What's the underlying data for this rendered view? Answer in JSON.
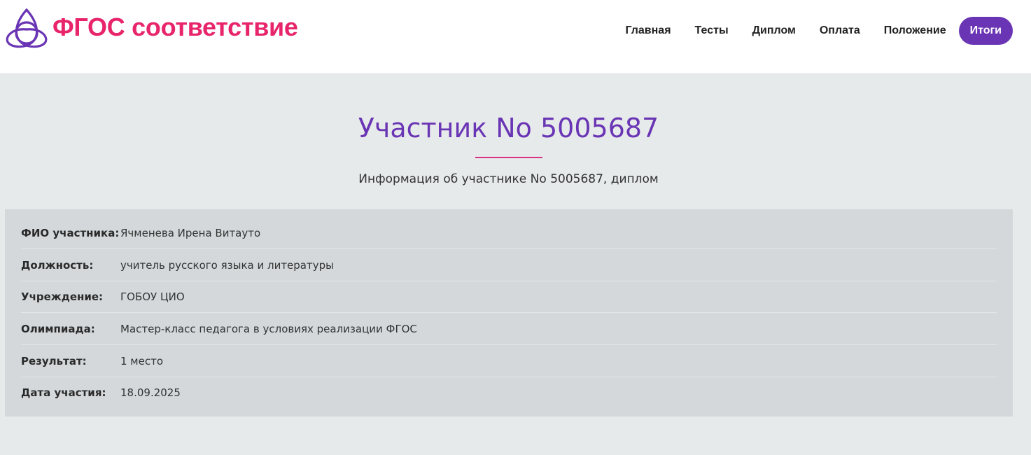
{
  "header": {
    "logo_text": "ФГОС соответствие",
    "logo_icon": "triquetra-icon",
    "nav": [
      {
        "label": "Главная",
        "active": false
      },
      {
        "label": "Тесты",
        "active": false
      },
      {
        "label": "Диплом",
        "active": false
      },
      {
        "label": "Оплата",
        "active": false
      },
      {
        "label": "Положение",
        "active": false
      },
      {
        "label": "Итоги",
        "active": true
      }
    ]
  },
  "main": {
    "title": "Участник No 5005687",
    "subtitle": "Информация об участнике No 5005687, диплом"
  },
  "participant": {
    "rows": [
      {
        "label": "ФИО участника:",
        "value": "Ячменева Ирена Витауто"
      },
      {
        "label": "Должность:",
        "value": "учитель русского языка и литературы"
      },
      {
        "label": "Учреждение:",
        "value": "ГОБОУ ЦИО"
      },
      {
        "label": "Олимпиада:",
        "value": "Мастер-класс педагога в условиях реализации ФГОС"
      },
      {
        "label": "Результат:",
        "value": "1 место"
      },
      {
        "label": "Дата участия:",
        "value": "18.09.2025"
      }
    ]
  },
  "colors": {
    "brand_pink": "#e8246b",
    "brand_purple": "#6a35b4",
    "accent_line": "#d63384",
    "page_bg": "#e7eaeb",
    "panel_bg": "#d4d8db"
  }
}
